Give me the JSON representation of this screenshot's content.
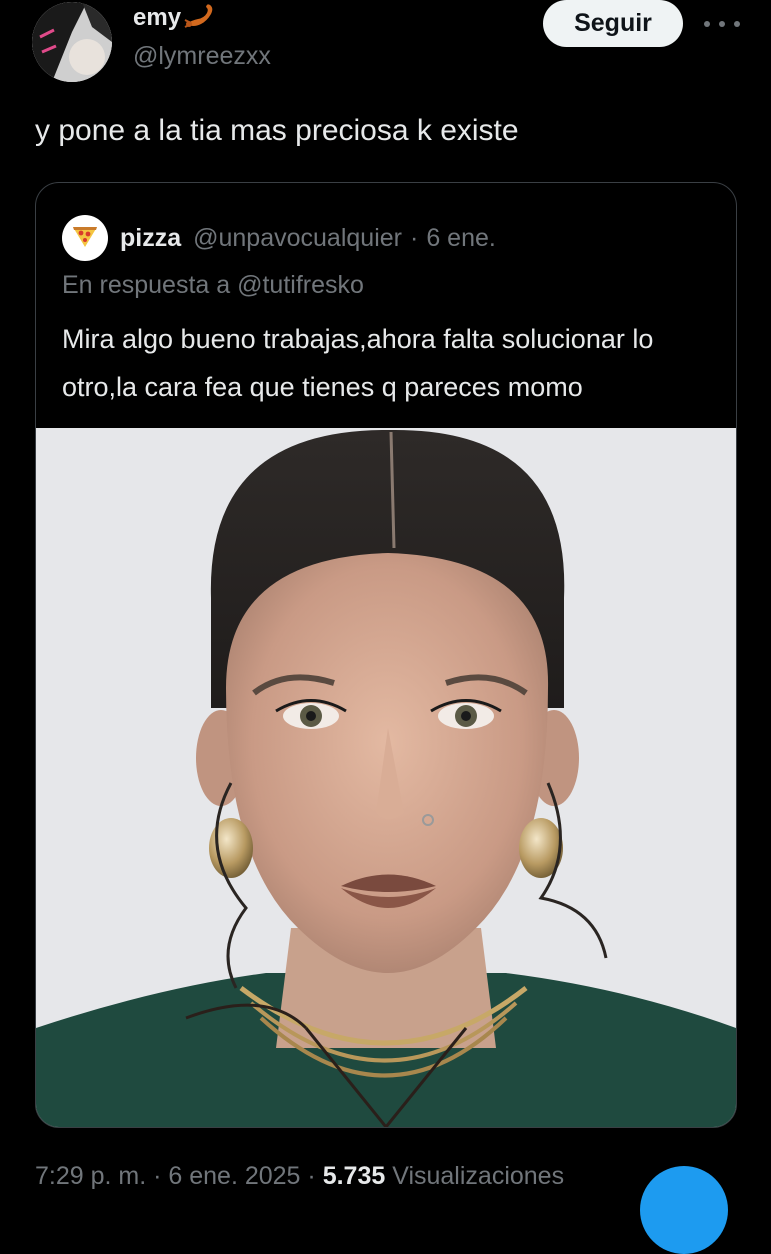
{
  "tweet": {
    "author_name": "emy",
    "author_handle": "@lymreezxx",
    "follow_label": "Seguir",
    "text": "y pone a la tia mas preciosa k existe",
    "timestamp": "7:29 p. m. · 6 ene. 2025",
    "separator": "·",
    "views_count": "5.735",
    "views_label": "Visualizaciones"
  },
  "quoted_tweet": {
    "author_name": "pizza",
    "author_handle": "@unpavocualquier",
    "separator": "·",
    "date": "6 ene.",
    "reply_to": "En respuesta a @tutifresko",
    "text": "Mira algo bueno trabajas,ahora falta solucionar lo otro,la cara fea que tienes q pareces momo"
  },
  "icons": {
    "more": "more-horizontal-icon",
    "scorpion": "scorpion-emoji-icon",
    "pizza": "pizza-emoji-icon"
  },
  "colors": {
    "background": "#000000",
    "primary_text": "#e7e9ea",
    "secondary_text": "#71767b",
    "follow_button_bg": "#eff3f4",
    "accent": "#1d9bf0",
    "border": "#3a3f44"
  }
}
